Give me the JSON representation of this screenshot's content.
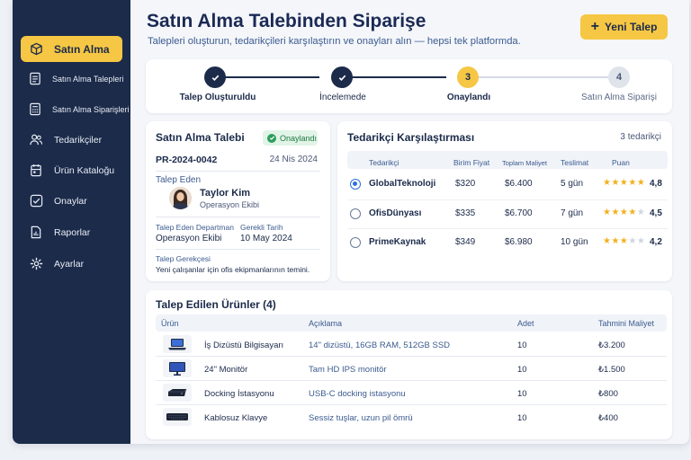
{
  "header": {
    "title": "Satın Alma Talebinden Siparişe",
    "subtitle": "Talepleri oluşturun, tedarikçileri karşılaştırın ve onayları alın — hepsi tek platformda.",
    "new_request_label": "Yeni Talep"
  },
  "sidebar": {
    "items": [
      {
        "label": "Satın Alma",
        "icon": "box-icon",
        "active": true
      },
      {
        "label": "Satın Alma Talepleri",
        "icon": "document-icon"
      },
      {
        "label": "Satın Alma Siparişleri",
        "icon": "calculator-icon"
      },
      {
        "label": "Tedarikçiler",
        "icon": "users-icon"
      },
      {
        "label": "Ürün Kataloğu",
        "icon": "catalog-icon"
      },
      {
        "label": "Onaylar",
        "icon": "check-square-icon"
      },
      {
        "label": "Raporlar",
        "icon": "report-icon"
      },
      {
        "label": "Ayarlar",
        "icon": "gear-icon"
      }
    ]
  },
  "stepper": {
    "steps": [
      {
        "label": "Talep Oluşturuldu",
        "state": "done"
      },
      {
        "label": "İncelemede",
        "state": "done"
      },
      {
        "label": "Onaylandı",
        "state": "current",
        "number": "3"
      },
      {
        "label": "Satın Alma Siparişi",
        "state": "todo",
        "number": "4"
      }
    ]
  },
  "request": {
    "title": "Satın Alma Talebi",
    "status": "Onaylandı",
    "id": "PR-2024-0042",
    "date": "24 Nis 2024",
    "requester_label": "Talep Eden",
    "requester_name": "Taylor Kim",
    "requester_dept": "Operasyon Ekibi",
    "dept_label": "Talep Eden Departman",
    "dept_value": "Operasyon Ekibi",
    "due_label": "Gerekli Tarih",
    "due_value": "10 May 2024",
    "reason_label": "Talep Gerekçesi",
    "reason_value": "Yeni çalışanlar için ofis ekipmanlarının temini."
  },
  "suppliers": {
    "title": "Tedarikçi Karşılaştırması",
    "count": "3 tedarikçi",
    "columns": [
      "Tedarikçi",
      "Birim Fiyat",
      "Toplam Maliyet",
      "Teslimat",
      "Puan"
    ],
    "rows": [
      {
        "name": "GlobalTeknoloji",
        "unit": "$320",
        "total": "$6.400",
        "delivery": "5 gün",
        "stars": 5,
        "rating": "4,8",
        "selected": true
      },
      {
        "name": "OfisDünyası",
        "unit": "$335",
        "total": "$6.700",
        "delivery": "7 gün",
        "stars": 4,
        "rating": "4,5",
        "selected": false
      },
      {
        "name": "PrimeKaynak",
        "unit": "$349",
        "total": "$6.980",
        "delivery": "10 gün",
        "stars": 3,
        "rating": "4,2",
        "selected": false
      }
    ]
  },
  "products": {
    "title": "Talep Edilen Ürünler (4)",
    "columns": [
      "Ürün",
      "Açıklama",
      "Adet",
      "Tahmini Maliyet"
    ],
    "rows": [
      {
        "name": "İş Dizüstü Bilgisayarı",
        "desc": "14\" dizüstü, 16GB RAM, 512GB SSD",
        "qty": "10",
        "cost": "₺3.200",
        "icon": "laptop-icon"
      },
      {
        "name": "24\" Monitör",
        "desc": "Tam HD IPS monitör",
        "qty": "10",
        "cost": "₺1.500",
        "icon": "monitor-icon"
      },
      {
        "name": "Docking İstasyonu",
        "desc": "USB-C docking istasyonu",
        "qty": "10",
        "cost": "₺800",
        "icon": "dock-icon"
      },
      {
        "name": "Kablosuz Klavye",
        "desc": "Sessiz tuşlar, uzun pil ömrü",
        "qty": "10",
        "cost": "₺400",
        "icon": "keyboard-icon"
      }
    ]
  },
  "colors": {
    "sidebar": "#1c2b4a",
    "accent": "#f6c744",
    "success": "#2f9e5c",
    "radio": "#2f6fe0",
    "star": "#f2b01e"
  }
}
